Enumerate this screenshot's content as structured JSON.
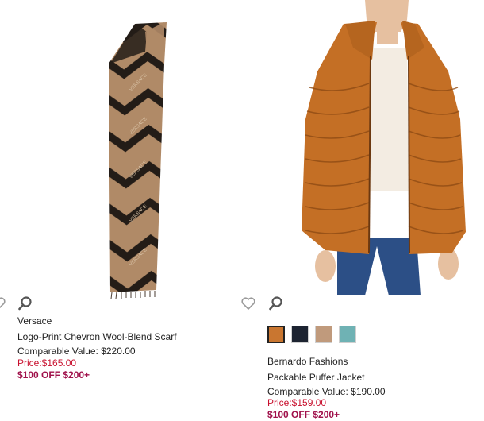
{
  "products": [
    {
      "brand": "Versace",
      "name": "Logo-Print Chevron Wool-Blend Scarf",
      "comparable_value": "Comparable Value: $220.00",
      "price": "Price:$165.00",
      "promo": "$100 OFF $200+",
      "image_icon": "scarf-image",
      "colors": {
        "light": "#b08a67",
        "dark": "#231c17",
        "fringe": "#4a3b30"
      }
    },
    {
      "brand": "Bernardo Fashions",
      "name": "Packable Puffer Jacket",
      "comparable_value": "Comparable Value: $190.00",
      "price": "Price:$159.00",
      "promo": "$100 OFF $200+",
      "image_icon": "puffer-jacket-image",
      "swatches": [
        {
          "color": "#c97630",
          "selected": true
        },
        {
          "color": "#1d2431",
          "selected": false
        },
        {
          "color": "#c09a7c",
          "selected": false
        },
        {
          "color": "#6fb2b4",
          "selected": false
        }
      ],
      "colors": {
        "jacket": "#c46f25",
        "jacket_dark": "#8f4b14",
        "jeans": "#2c4f86",
        "shirt": "#f3ece2",
        "skin": "#e6c0a0"
      }
    }
  ],
  "icons": {
    "wishlist": "heart-icon",
    "quick_view": "magnifier-icon"
  },
  "colors": {
    "price": "#c8102e",
    "promo": "#a0114b",
    "icon": "#555555",
    "heart": "#9a9a9a"
  }
}
